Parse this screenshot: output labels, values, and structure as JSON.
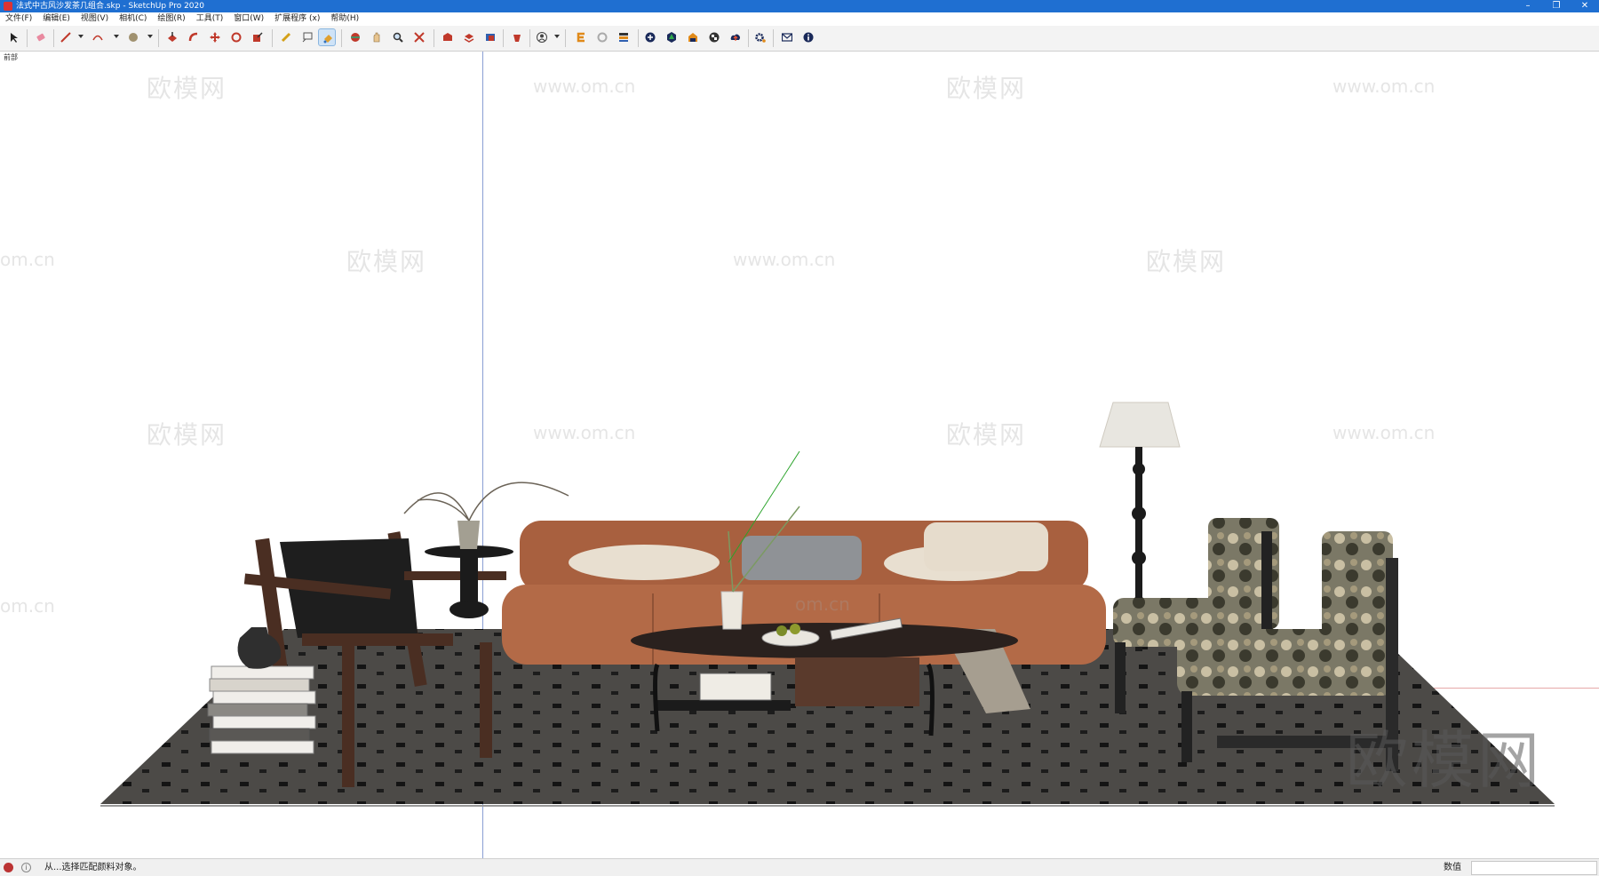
{
  "window": {
    "title": "法式中古风沙发茶几组合.skp - SketchUp Pro 2020",
    "controls": [
      "–",
      "❐",
      "✕"
    ]
  },
  "menu": [
    "文件(F)",
    "编辑(E)",
    "视图(V)",
    "相机(C)",
    "绘图(R)",
    "工具(T)",
    "窗口(W)",
    "扩展程序 (x)",
    "帮助(H)"
  ],
  "scene": {
    "label": "前部",
    "watermarks": {
      "site": "www.om.cn",
      "brand": "欧模网",
      "brand_large": "欧模网",
      "partial": "om.cn"
    }
  },
  "status": {
    "message": "从...选择匹配颜料对象。",
    "measure_label": "数值",
    "measure_value": ""
  },
  "colors": {
    "titlebar": "#1f6fd1",
    "sofa": "#b36a47",
    "rug": "#4c4a47"
  }
}
